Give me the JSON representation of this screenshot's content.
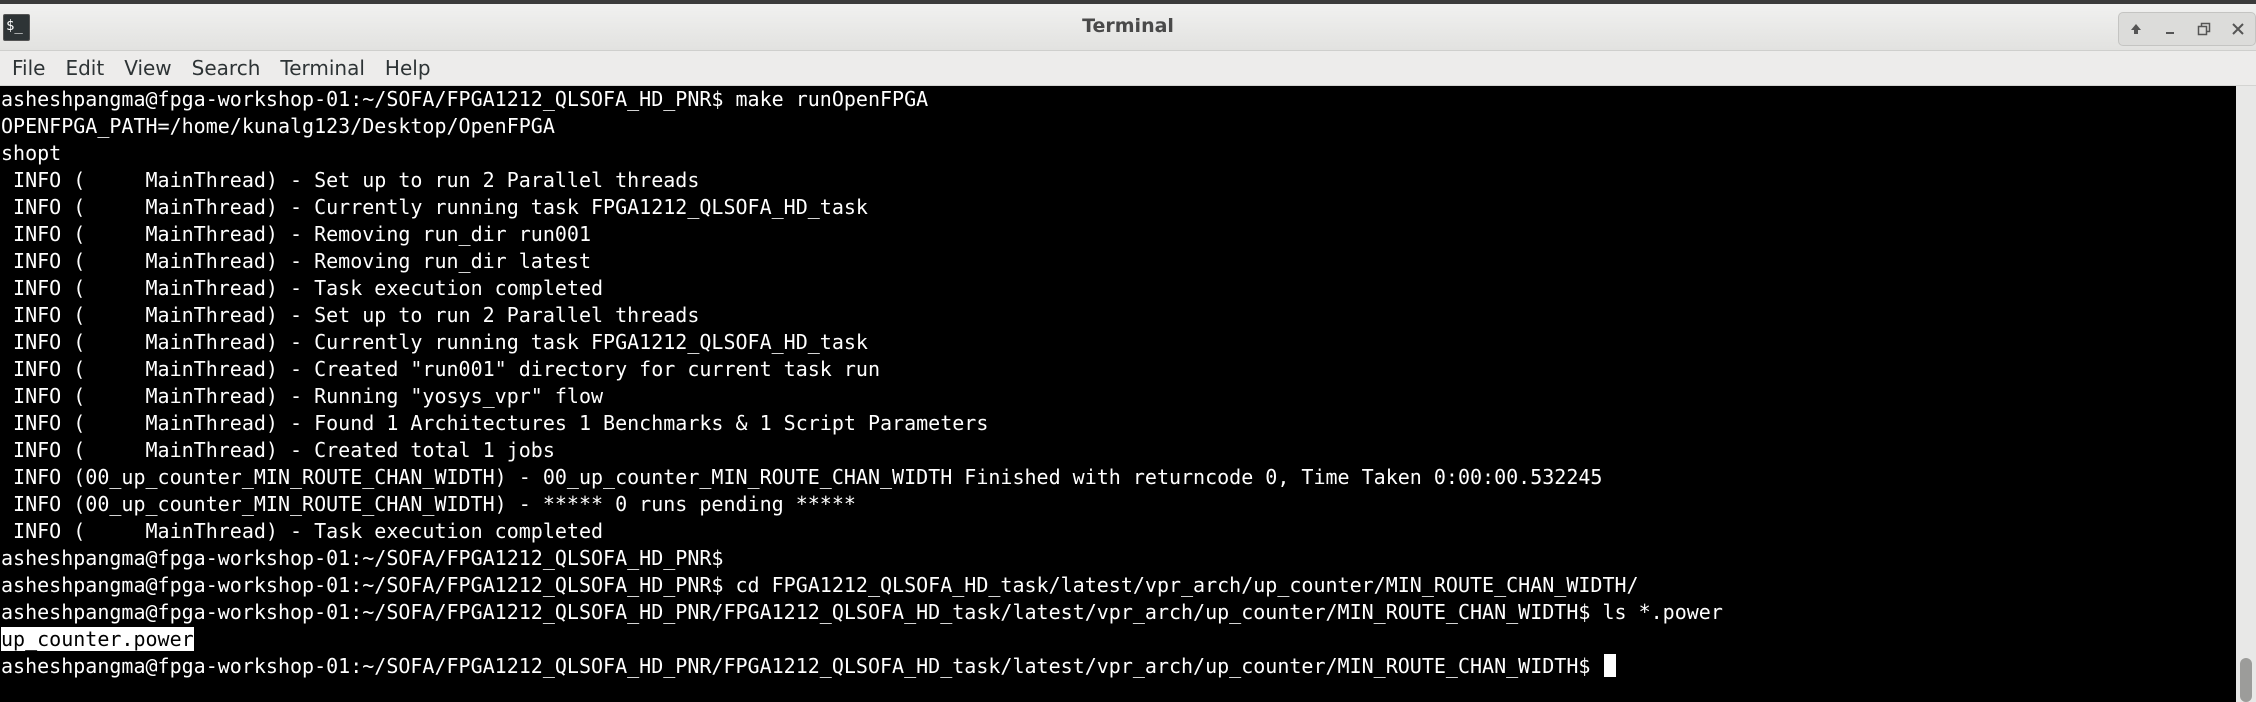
{
  "window": {
    "title": "Terminal"
  },
  "menubar": {
    "items": [
      "File",
      "Edit",
      "View",
      "Search",
      "Terminal",
      "Help"
    ]
  },
  "icons": {
    "app": "terminal-icon",
    "controls": [
      "maximize-up-icon",
      "minimize-icon",
      "restore-icon",
      "close-icon"
    ]
  },
  "terminal": {
    "lines": [
      "asheshpangma@fpga-workshop-01:~/SOFA/FPGA1212_QLSOFA_HD_PNR$ make runOpenFPGA",
      "OPENFPGA_PATH=/home/kunalg123/Desktop/OpenFPGA",
      "shopt",
      " INFO (     MainThread) - Set up to run 2 Parallel threads",
      " INFO (     MainThread) - Currently running task FPGA1212_QLSOFA_HD_task",
      " INFO (     MainThread) - Removing run_dir run001",
      " INFO (     MainThread) - Removing run_dir latest",
      " INFO (     MainThread) - Task execution completed",
      " INFO (     MainThread) - Set up to run 2 Parallel threads",
      " INFO (     MainThread) - Currently running task FPGA1212_QLSOFA_HD_task",
      " INFO (     MainThread) - Created \"run001\" directory for current task run",
      " INFO (     MainThread) - Running \"yosys_vpr\" flow",
      " INFO (     MainThread) - Found 1 Architectures 1 Benchmarks & 1 Script Parameters",
      " INFO (     MainThread) - Created total 1 jobs",
      " INFO (00_up_counter_MIN_ROUTE_CHAN_WIDTH) - 00_up_counter_MIN_ROUTE_CHAN_WIDTH Finished with returncode 0, Time Taken 0:00:00.532245",
      " INFO (00_up_counter_MIN_ROUTE_CHAN_WIDTH) - ***** 0 runs pending *****",
      " INFO (     MainThread) - Task execution completed",
      "asheshpangma@fpga-workshop-01:~/SOFA/FPGA1212_QLSOFA_HD_PNR$",
      "asheshpangma@fpga-workshop-01:~/SOFA/FPGA1212_QLSOFA_HD_PNR$ cd FPGA1212_QLSOFA_HD_task/latest/vpr_arch/up_counter/MIN_ROUTE_CHAN_WIDTH/",
      "asheshpangma@fpga-workshop-01:~/SOFA/FPGA1212_QLSOFA_HD_PNR/FPGA1212_QLSOFA_HD_task/latest/vpr_arch/up_counter/MIN_ROUTE_CHAN_WIDTH$ ls *.power"
    ],
    "highlighted_output": "up_counter.power",
    "prompt_line": "asheshpangma@fpga-workshop-01:~/SOFA/FPGA1212_QLSOFA_HD_PNR/FPGA1212_QLSOFA_HD_task/latest/vpr_arch/up_counter/MIN_ROUTE_CHAN_WIDTH$ "
  },
  "colors": {
    "terminal_bg": "#000000",
    "terminal_fg": "#ffffff",
    "titlebar_bg": "#e9e9e7",
    "menubar_bg": "#edeceb"
  }
}
